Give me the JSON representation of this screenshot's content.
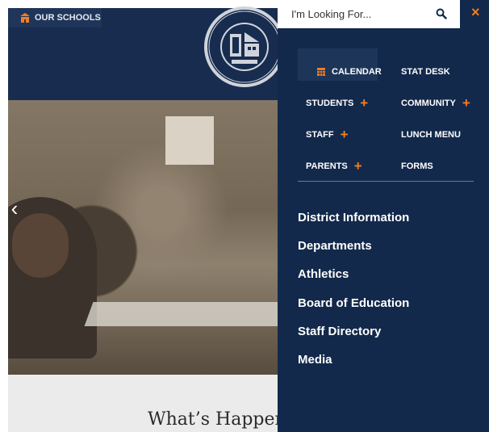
{
  "header": {
    "our_schools_label": "OUR SCHOOLS",
    "seal_icon": "district-seal-icon",
    "brand_color": "#172c4f"
  },
  "hero": {
    "prev_arrow": "‹",
    "image_icon": "classroom-photo"
  },
  "happening": {
    "title": "What’s Happening"
  },
  "search": {
    "placeholder": "I'm Looking For...",
    "value": ""
  },
  "menu": {
    "close_label": "×",
    "accent_color": "#f47c20",
    "background_color": "#13294b",
    "quick_links": [
      {
        "label": "CALENDAR",
        "icon": "calendar-icon"
      },
      {
        "label": "STAT DESK"
      },
      {
        "label": "STUDENTS",
        "expand": "+"
      },
      {
        "label": "COMMUNITY",
        "expand": "+"
      },
      {
        "label": "STAFF",
        "expand": "+"
      },
      {
        "label": "LUNCH MENU"
      },
      {
        "label": "PARENTS",
        "expand": "+"
      },
      {
        "label": "FORMS"
      }
    ],
    "main_links": [
      "District Information",
      "Departments",
      "Athletics",
      "Board of Education",
      "Staff Directory",
      "Media"
    ]
  }
}
